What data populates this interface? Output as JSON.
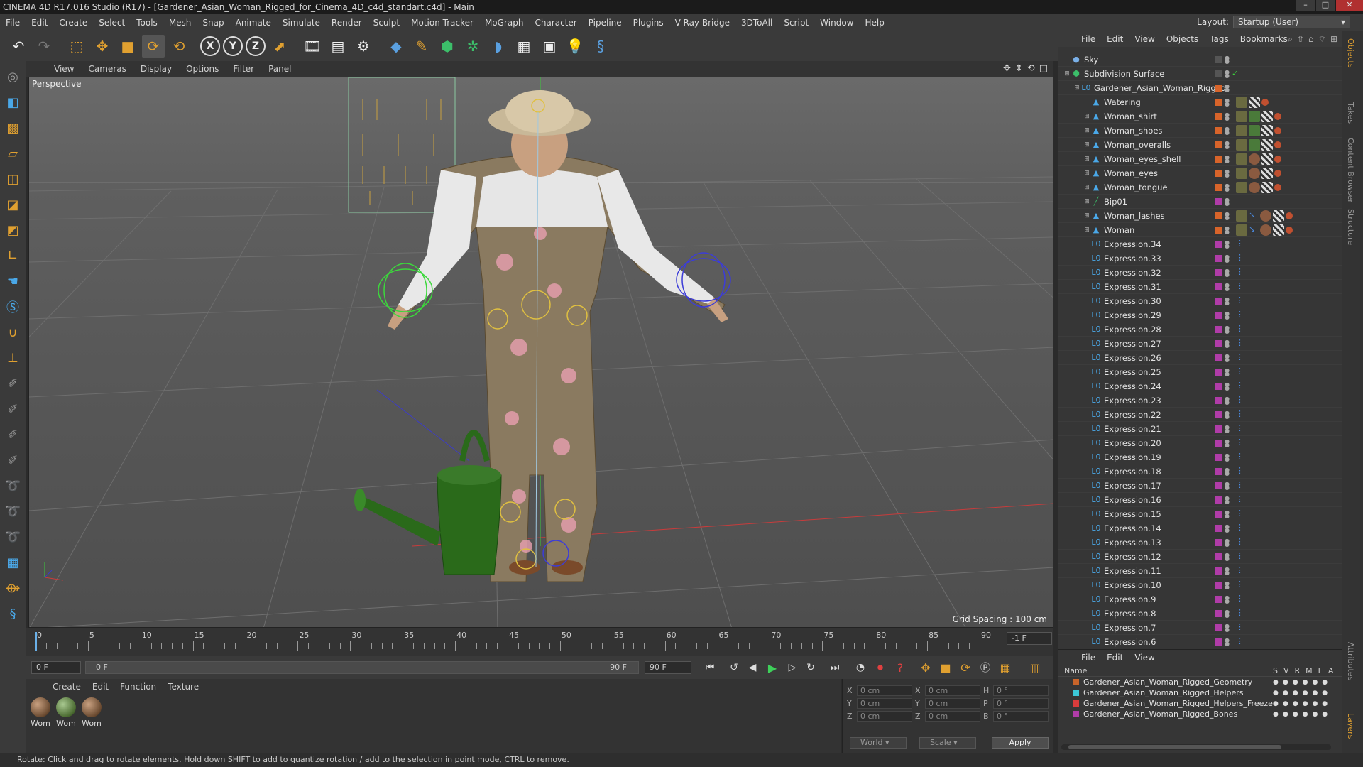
{
  "window": {
    "title": "CINEMA 4D R17.016 Studio (R17) - [Gardener_Asian_Woman_Rigged_for_Cinema_4D_c4d_standart.c4d] - Main"
  },
  "menubar": {
    "items": [
      "File",
      "Edit",
      "Create",
      "Select",
      "Tools",
      "Mesh",
      "Snap",
      "Animate",
      "Simulate",
      "Render",
      "Sculpt",
      "Motion Tracker",
      "MoGraph",
      "Character",
      "Pipeline",
      "Plugins",
      "V-Ray Bridge",
      "3DToAll",
      "Script",
      "Window",
      "Help"
    ],
    "layout_label": "Layout:",
    "layout_value": "Startup (User)"
  },
  "viewport": {
    "menu": [
      "View",
      "Cameras",
      "Display",
      "Options",
      "Filter",
      "Panel"
    ],
    "camera_label": "Perspective",
    "grid_spacing": "Grid Spacing : 100 cm"
  },
  "timeline": {
    "ticks": [
      "0",
      "5",
      "10",
      "15",
      "20",
      "25",
      "30",
      "35",
      "40",
      "45",
      "50",
      "55",
      "60",
      "65",
      "70",
      "75",
      "80",
      "85",
      "90"
    ],
    "end_frame_box": "-1 F"
  },
  "transport": {
    "start_frame": "0 F",
    "slider_start": "0 F",
    "slider_end": "90 F",
    "end_frame": "90 F"
  },
  "materials": {
    "menu": [
      "Create",
      "Edit",
      "Function",
      "Texture"
    ],
    "items": [
      "Wom",
      "Wom",
      "Wom"
    ]
  },
  "coordinates": {
    "rows": [
      {
        "a_label": "X",
        "a_val": "0 cm",
        "b_label": "X",
        "b_val": "0 cm",
        "c_label": "H",
        "c_val": "0 °"
      },
      {
        "a_label": "Y",
        "a_val": "0 cm",
        "b_label": "Y",
        "b_val": "0 cm",
        "c_label": "P",
        "c_val": "0 °"
      },
      {
        "a_label": "Z",
        "a_val": "0 cm",
        "b_label": "Z",
        "b_val": "0 cm",
        "c_label": "B",
        "c_val": "0 °"
      }
    ],
    "mode": "World",
    "type": "Scale",
    "apply": "Apply"
  },
  "status": {
    "text": "Rotate: Click and drag to rotate elements. Hold down SHIFT to add to quantize rotation / add to the selection in point mode, CTRL to remove."
  },
  "objects": {
    "menu": [
      "File",
      "Edit",
      "View",
      "Objects",
      "Tags",
      "Bookmarks"
    ],
    "rows": [
      {
        "name": "Sky",
        "indent": 0,
        "icon": "sky"
      },
      {
        "name": "Subdivision Surface",
        "indent": 0,
        "icon": "subdiv"
      },
      {
        "name": "Gardener_Asian_Woman_Rigged",
        "indent": 1,
        "icon": "null"
      },
      {
        "name": "Watering",
        "indent": 2,
        "icon": "poly"
      },
      {
        "name": "Woman_shirt",
        "indent": 2,
        "icon": "poly"
      },
      {
        "name": "Woman_shoes",
        "indent": 2,
        "icon": "poly"
      },
      {
        "name": "Woman_overalls",
        "indent": 2,
        "icon": "poly"
      },
      {
        "name": "Woman_eyes_shell",
        "indent": 2,
        "icon": "poly"
      },
      {
        "name": "Woman_eyes",
        "indent": 2,
        "icon": "poly"
      },
      {
        "name": "Woman_tongue",
        "indent": 2,
        "icon": "poly"
      },
      {
        "name": "Bip01",
        "indent": 2,
        "icon": "bone"
      },
      {
        "name": "Woman_lashes",
        "indent": 2,
        "icon": "poly"
      },
      {
        "name": "Woman",
        "indent": 2,
        "icon": "poly"
      },
      {
        "name": "Expression.34",
        "indent": 2,
        "icon": "expr"
      },
      {
        "name": "Expression.33",
        "indent": 2,
        "icon": "expr"
      },
      {
        "name": "Expression.32",
        "indent": 2,
        "icon": "expr"
      },
      {
        "name": "Expression.31",
        "indent": 2,
        "icon": "expr"
      },
      {
        "name": "Expression.30",
        "indent": 2,
        "icon": "expr"
      },
      {
        "name": "Expression.29",
        "indent": 2,
        "icon": "expr"
      },
      {
        "name": "Expression.28",
        "indent": 2,
        "icon": "expr"
      },
      {
        "name": "Expression.27",
        "indent": 2,
        "icon": "expr"
      },
      {
        "name": "Expression.26",
        "indent": 2,
        "icon": "expr"
      },
      {
        "name": "Expression.25",
        "indent": 2,
        "icon": "expr"
      },
      {
        "name": "Expression.24",
        "indent": 2,
        "icon": "expr"
      },
      {
        "name": "Expression.23",
        "indent": 2,
        "icon": "expr"
      },
      {
        "name": "Expression.22",
        "indent": 2,
        "icon": "expr"
      },
      {
        "name": "Expression.21",
        "indent": 2,
        "icon": "expr"
      },
      {
        "name": "Expression.20",
        "indent": 2,
        "icon": "expr"
      },
      {
        "name": "Expression.19",
        "indent": 2,
        "icon": "expr"
      },
      {
        "name": "Expression.18",
        "indent": 2,
        "icon": "expr"
      },
      {
        "name": "Expression.17",
        "indent": 2,
        "icon": "expr"
      },
      {
        "name": "Expression.16",
        "indent": 2,
        "icon": "expr"
      },
      {
        "name": "Expression.15",
        "indent": 2,
        "icon": "expr"
      },
      {
        "name": "Expression.14",
        "indent": 2,
        "icon": "expr"
      },
      {
        "name": "Expression.13",
        "indent": 2,
        "icon": "expr"
      },
      {
        "name": "Expression.12",
        "indent": 2,
        "icon": "expr"
      },
      {
        "name": "Expression.11",
        "indent": 2,
        "icon": "expr"
      },
      {
        "name": "Expression.10",
        "indent": 2,
        "icon": "expr"
      },
      {
        "name": "Expression.9",
        "indent": 2,
        "icon": "expr"
      },
      {
        "name": "Expression.8",
        "indent": 2,
        "icon": "expr"
      },
      {
        "name": "Expression.7",
        "indent": 2,
        "icon": "expr"
      },
      {
        "name": "Expression.6",
        "indent": 2,
        "icon": "expr"
      }
    ]
  },
  "layers": {
    "menu": [
      "File",
      "Edit",
      "View"
    ],
    "header_name": "Name",
    "header_cols": [
      "S",
      "V",
      "R",
      "M",
      "L",
      "A"
    ],
    "rows": [
      {
        "name": "Gardener_Asian_Woman_Rigged_Geometry",
        "color": "#c8642a"
      },
      {
        "name": "Gardener_Asian_Woman_Rigged_Helpers",
        "color": "#3cc8d8"
      },
      {
        "name": "Gardener_Asian_Woman_Rigged_Helpers_Freeze",
        "color": "#d83c3c"
      },
      {
        "name": "Gardener_Asian_Woman_Rigged_Bones",
        "color": "#b03ca8"
      }
    ]
  },
  "side_tabs": [
    "Objects",
    "Takes",
    "Content Browser",
    "Structure",
    "Attributes",
    "Layers"
  ]
}
